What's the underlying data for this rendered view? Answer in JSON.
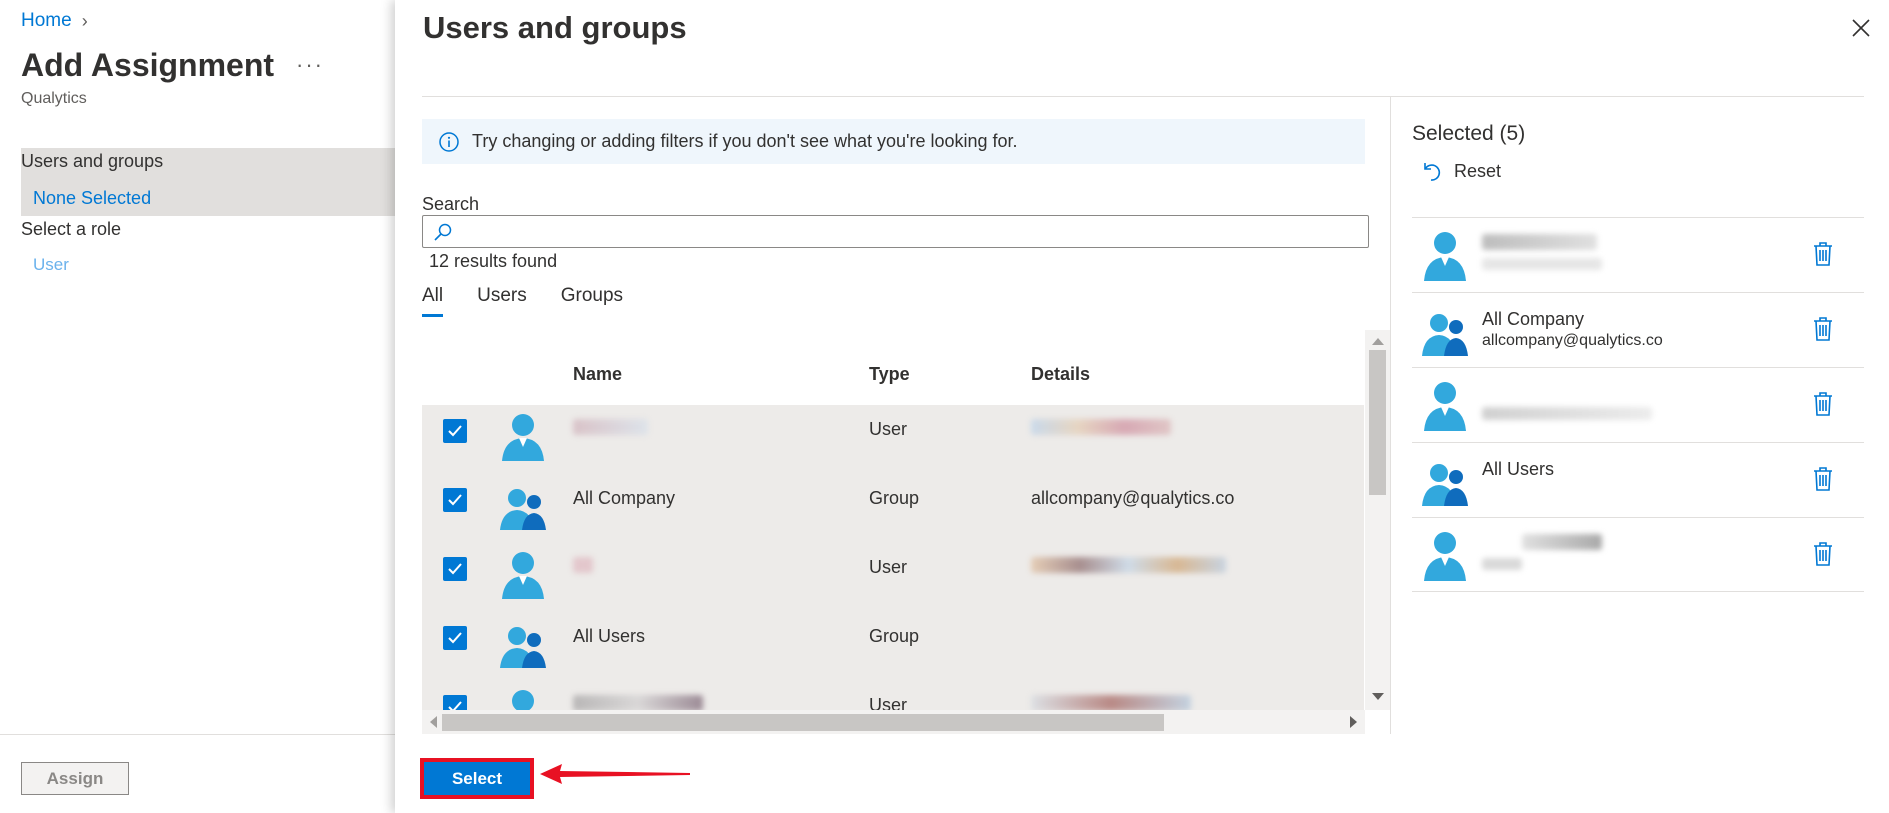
{
  "left": {
    "breadcrumb_home": "Home",
    "title": "Add Assignment",
    "more": "···",
    "subtitle": "Qualytics",
    "nav": {
      "users_groups_label": "Users and groups",
      "users_groups_value": "None Selected",
      "role_label": "Select a role",
      "role_value": "User"
    },
    "assign_label": "Assign"
  },
  "panel": {
    "title": "Users and groups",
    "info_text": "Try changing or adding filters if you don't see what you're looking for.",
    "search_label": "Search",
    "search_value": "",
    "results_text": "12 results found",
    "tabs": [
      {
        "label": "All",
        "active": true
      },
      {
        "label": "Users",
        "active": false
      },
      {
        "label": "Groups",
        "active": false
      }
    ],
    "columns": {
      "name": "Name",
      "type": "Type",
      "details": "Details"
    },
    "rows": [
      {
        "name": "",
        "type": "User",
        "details": "",
        "kind": "user",
        "checked": true
      },
      {
        "name": "All Company",
        "type": "Group",
        "details": "allcompany@qualytics.co",
        "kind": "group",
        "checked": true
      },
      {
        "name": "",
        "type": "User",
        "details": "",
        "kind": "user",
        "checked": true
      },
      {
        "name": "All Users",
        "type": "Group",
        "details": "",
        "kind": "group",
        "checked": true
      },
      {
        "name": "",
        "type": "User",
        "details": "",
        "kind": "user",
        "checked": true
      }
    ],
    "selected": {
      "title": "Selected (5)",
      "reset_label": "Reset",
      "items": [
        {
          "name": "",
          "email": "",
          "kind": "user"
        },
        {
          "name": "All Company",
          "email": "allcompany@qualytics.co",
          "kind": "group"
        },
        {
          "name": "",
          "email": "",
          "kind": "user"
        },
        {
          "name": "All Users",
          "email": "",
          "kind": "group"
        },
        {
          "name": "",
          "email": "",
          "kind": "user"
        }
      ]
    },
    "select_label": "Select"
  },
  "colors": {
    "accent": "#0078d4",
    "highlight": "#e81123"
  }
}
